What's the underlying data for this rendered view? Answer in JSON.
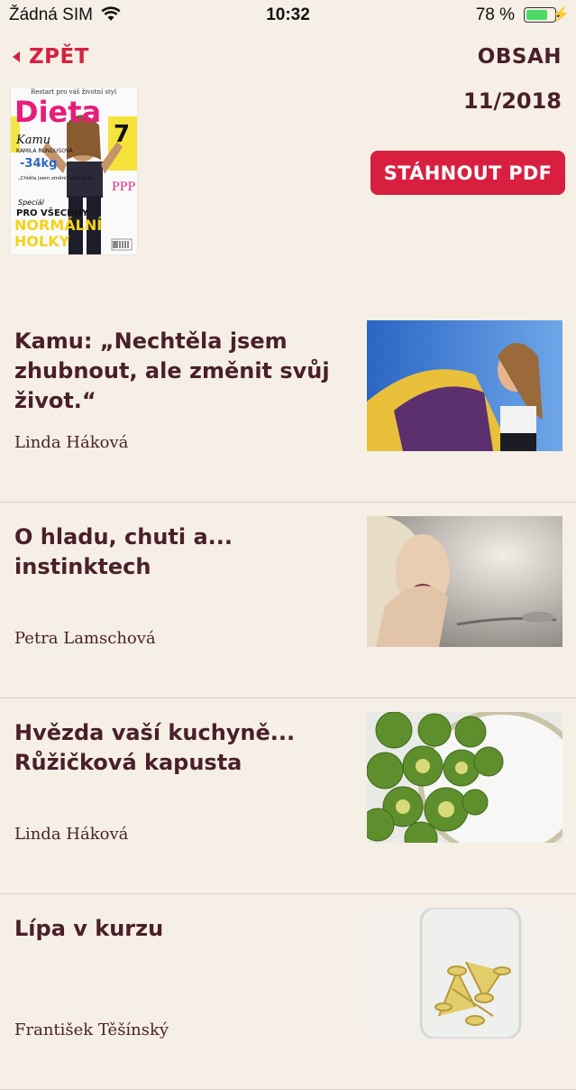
{
  "status": {
    "carrier": "Žádná SIM",
    "time": "10:32",
    "battery": "78 %",
    "battery_level": 0.78
  },
  "nav": {
    "back_label": "ZPĚT",
    "contents_label": "OBSAH"
  },
  "issue": {
    "date": "11/2018",
    "download_label": "STÁHNOUT PDF",
    "cover": {
      "tagline": "Restart pro váš životní styl",
      "logo": "Dieta",
      "name": "Kamu",
      "subname": "KAMILA RUNDUSOVÁ",
      "kg": "-34kg",
      "quote": "„Chtěla jsem změnit svůj život.“",
      "number": "7",
      "ppp": "PPP",
      "special": "Speciál",
      "headline1": "PRO VŠECHNY",
      "headline2": "NORMÁLNÍ",
      "headline3": "HOLKY"
    }
  },
  "articles": [
    {
      "title": "Kamu: „Nechtěla jsem zhubnout, ale změnit svůj život.“",
      "author": "Linda Háková"
    },
    {
      "title": "O hladu, chuti a... instinktech",
      "author": "Petra Lamschová"
    },
    {
      "title": "Hvězda vaší kuchyně... Růžičková kapusta",
      "author": "Linda Háková"
    },
    {
      "title": "Lípa v kurzu",
      "author": "František Těšínský"
    }
  ],
  "colors": {
    "accent": "#d81f3f",
    "text": "#4a1f2a",
    "background": "#f5efe6"
  }
}
